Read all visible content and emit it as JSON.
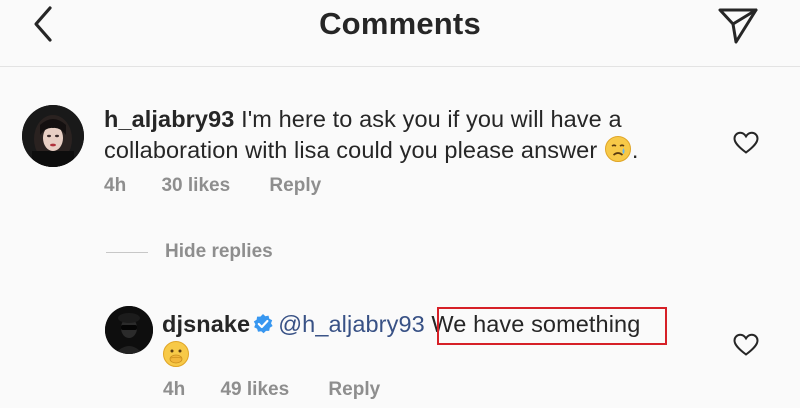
{
  "header": {
    "title": "Comments",
    "back_icon": "chevron-left-icon",
    "share_icon": "paper-plane-icon"
  },
  "comments": [
    {
      "username": "h_aljabry93",
      "text": "I'm here to ask you if you will have a collaboration with lisa could you please answer",
      "emoji": "crying-face-emoji",
      "text_end": ".",
      "time": "4h",
      "likes": "30 likes",
      "reply": "Reply"
    }
  ],
  "replies_toggle": {
    "label": "Hide replies"
  },
  "replies": [
    {
      "username": "djsnake",
      "verified": true,
      "mention": "@h_aljabry93",
      "text": "We have something",
      "emoji": "shushing-face-emoji",
      "time": "4h",
      "likes": "49 likes",
      "reply": "Reply"
    }
  ],
  "colors": {
    "background": "#fafafa",
    "text": "#262626",
    "muted": "#8e8e8e",
    "mention": "#385185",
    "verified": "#3897f0",
    "highlight_box": "#d62027"
  }
}
